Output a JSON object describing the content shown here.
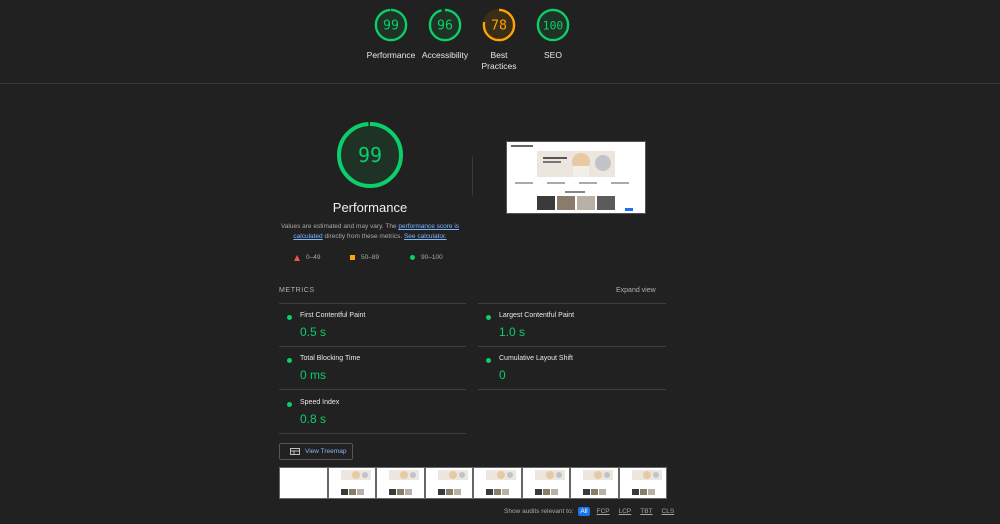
{
  "categories": [
    {
      "score": "99",
      "label": "Performance",
      "value": 0.99,
      "color": "#0cce6b"
    },
    {
      "score": "96",
      "label": "Accessibility",
      "value": 0.96,
      "color": "#0cce6b"
    },
    {
      "score": "78",
      "label": "Best Practices",
      "value": 0.78,
      "color": "#ffa400"
    },
    {
      "score": "100",
      "label": "SEO",
      "value": 1.0,
      "color": "#0cce6b"
    }
  ],
  "main": {
    "score": "99",
    "value": 0.99,
    "color": "#0cce6b",
    "title": "Performance",
    "desc_prefix": "Values are estimated and may vary. The ",
    "desc_link1": "performance score is calculated",
    "desc_middle": " directly from these metrics. ",
    "desc_link2": "See calculator."
  },
  "legend": {
    "fail": "0–49",
    "average": "50–89",
    "pass": "90–100",
    "fail_color": "#ff4e42",
    "average_color": "#ffa400",
    "pass_color": "#0cce6b"
  },
  "metrics": {
    "header": "METRICS",
    "expand_label": "Expand view",
    "items": [
      {
        "name": "First Contentful Paint",
        "value": "0.5 s"
      },
      {
        "name": "Largest Contentful Paint",
        "value": "1.0 s"
      },
      {
        "name": "Total Blocking Time",
        "value": "0 ms"
      },
      {
        "name": "Cumulative Layout Shift",
        "value": "0"
      },
      {
        "name": "Speed Index",
        "value": "0.8 s"
      }
    ]
  },
  "treemap_label": "View Treemap",
  "filter": {
    "label": "Show audits relevant to:",
    "options": [
      "All",
      "FCP",
      "LCP",
      "TBT",
      "CLS"
    ]
  },
  "icons": {
    "treemap": "treemap-icon",
    "fail": "triangle-icon",
    "average": "square-icon",
    "pass": "circle-icon"
  }
}
